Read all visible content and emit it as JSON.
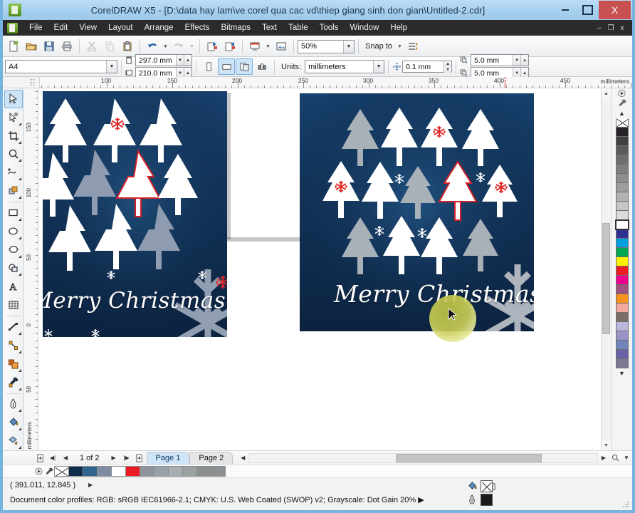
{
  "window": {
    "title": "CorelDRAW X5 - [D:\\data hay lam\\ve corel qua cac vd\\thiep giang sinh don gian\\Untitled-2.cdr]",
    "app_icon": "coreldraw-icon",
    "minimize_label": "–",
    "maximize_label": "❑",
    "close_label": "X"
  },
  "menubar": {
    "items": [
      {
        "label": "File"
      },
      {
        "label": "Edit"
      },
      {
        "label": "View"
      },
      {
        "label": "Layout"
      },
      {
        "label": "Arrange"
      },
      {
        "label": "Effects"
      },
      {
        "label": "Bitmaps"
      },
      {
        "label": "Text"
      },
      {
        "label": "Table"
      },
      {
        "label": "Tools"
      },
      {
        "label": "Window"
      },
      {
        "label": "Help"
      }
    ],
    "doc_minimize": "–",
    "doc_restore": "❐",
    "doc_close": "x"
  },
  "toolbar_standard": {
    "buttons": [
      {
        "name": "new-document-button",
        "icon": "new-page-icon"
      },
      {
        "name": "open-document-button",
        "icon": "folder-open-icon"
      },
      {
        "name": "save-document-button",
        "icon": "floppy-disk-icon"
      },
      {
        "name": "print-button",
        "icon": "printer-icon"
      },
      {
        "name": "cut-button",
        "icon": "scissors-icon"
      },
      {
        "name": "copy-button",
        "icon": "copy-icon"
      },
      {
        "name": "paste-button",
        "icon": "clipboard-icon"
      },
      {
        "name": "undo-button",
        "icon": "undo-arrow-icon"
      },
      {
        "name": "redo-button",
        "icon": "redo-arrow-icon"
      },
      {
        "name": "import-button",
        "icon": "import-icon"
      },
      {
        "name": "export-button",
        "icon": "export-icon"
      },
      {
        "name": "application-launcher-button",
        "icon": "app-launcher-icon"
      },
      {
        "name": "corel-online-button",
        "icon": "corel-online-icon"
      }
    ],
    "zoom_level": "50%",
    "snap_to_label": "Snap to",
    "options_icon": "options-icon"
  },
  "toolbar_properties": {
    "page_size": "A4",
    "page_width": "297.0 mm",
    "page_height": "210.0 mm",
    "orientation_portrait_icon": "portrait-icon",
    "orientation_landscape_icon": "landscape-icon",
    "all_pages_icon": "all-pages-icon",
    "current_page_icon": "current-page-icon",
    "units_label": "Units:",
    "units_value": "millimeters",
    "nudge_icon": "nudge-icon",
    "nudge_value": "0.1 mm",
    "duplicate_x_label": "x",
    "duplicate_x_value": "5.0 mm",
    "duplicate_y_label": "y",
    "duplicate_y_value": "5.0 mm"
  },
  "toolbox": {
    "tools": [
      {
        "name": "pick-tool",
        "icon": "arrow-cursor-icon",
        "active": true,
        "flyout": false
      },
      {
        "name": "shape-tool",
        "icon": "node-edit-icon",
        "active": false,
        "flyout": true
      },
      {
        "name": "crop-tool",
        "icon": "crop-icon",
        "active": false,
        "flyout": true
      },
      {
        "name": "zoom-tool",
        "icon": "magnifier-icon",
        "active": false,
        "flyout": true
      },
      {
        "name": "freehand-tool",
        "icon": "freehand-curve-icon",
        "active": false,
        "flyout": true
      },
      {
        "name": "smart-fill-tool",
        "icon": "smart-fill-icon",
        "active": false,
        "flyout": true
      },
      {
        "name": "rectangle-tool",
        "icon": "rectangle-icon",
        "active": false,
        "flyout": true
      },
      {
        "name": "ellipse-tool",
        "icon": "ellipse-icon",
        "active": false,
        "flyout": true
      },
      {
        "name": "polygon-tool",
        "icon": "polygon-icon",
        "active": false,
        "flyout": true
      },
      {
        "name": "basic-shapes-tool",
        "icon": "basic-shapes-icon",
        "active": false,
        "flyout": true
      },
      {
        "name": "text-tool",
        "icon": "letter-a-icon",
        "active": false,
        "flyout": false
      },
      {
        "name": "table-tool",
        "icon": "table-grid-icon",
        "active": false,
        "flyout": false
      },
      {
        "name": "dimension-tool",
        "icon": "dimension-line-icon",
        "active": false,
        "flyout": true
      },
      {
        "name": "connector-tool",
        "icon": "connector-line-icon",
        "active": false,
        "flyout": true
      },
      {
        "name": "blend-tool",
        "icon": "blend-icon",
        "active": false,
        "flyout": true
      },
      {
        "name": "color-eyedropper-tool",
        "icon": "eyedropper-icon",
        "active": false,
        "flyout": true
      },
      {
        "name": "outline-tool",
        "icon": "pen-nib-icon",
        "active": false,
        "flyout": true
      },
      {
        "name": "fill-tool",
        "icon": "paint-bucket-icon",
        "active": false,
        "flyout": true
      },
      {
        "name": "interactive-fill-tool",
        "icon": "interactive-fill-icon",
        "active": false,
        "flyout": true
      }
    ]
  },
  "rulers": {
    "horizontal_unit": "millimeters",
    "horizontal_labels": [
      "100",
      "150",
      "200",
      "250",
      "300",
      "350",
      "400",
      "450"
    ],
    "vertical_unit": "millimeters",
    "vertical_labels": [
      "150",
      "100",
      "50",
      "0",
      "50"
    ]
  },
  "canvas": {
    "card_left": {
      "name": "christmas-card-page-1",
      "greeting": "Merry Christmas",
      "background_color": "#123157",
      "tree_white": "#ffffff",
      "tree_grey": "#8e9bb0",
      "tree_red_outline": "#d32028",
      "snowflake_red": "#e02b2b",
      "snowflake_white": "#ffffff",
      "big_flake_color": "#9aa6b8"
    },
    "card_right": {
      "name": "christmas-card-page-2",
      "greeting": "Merry Christmas",
      "background_color": "#123157",
      "tree_white": "#ffffff",
      "tree_grey": "#a8b0b8",
      "tree_red_outline": "#d32028",
      "snowflake_red": "#e02b2b",
      "snowflake_white": "#ffffff",
      "big_flake_color": "#b6bcc4"
    },
    "cursor": {
      "name": "mouse-cursor",
      "glow_color": "#c5ca4e"
    }
  },
  "page_navigator": {
    "first_page_icon": "first-page-icon",
    "prev_page_icon": "prev-page-icon",
    "next_page_icon": "next-page-icon",
    "last_page_icon": "last-page-icon",
    "add_page_before_icon": "add-page-before-icon",
    "add_page_after_icon": "add-page-after-icon",
    "counter": "1 of 2",
    "tabs": [
      {
        "label": "Page 1",
        "active": true
      },
      {
        "label": "Page 2",
        "active": false
      }
    ]
  },
  "document_palette": {
    "expand_icon": "palette-expand-icon",
    "eyedropper_icon": "eyedropper-icon",
    "swatches": [
      {
        "name": "no-color",
        "color": "none"
      },
      {
        "name": "dark-navy",
        "color": "#0f2c4d"
      },
      {
        "name": "steel-blue",
        "color": "#2f648f"
      },
      {
        "name": "slate-blue-grey",
        "color": "#7d8ca3"
      },
      {
        "name": "white",
        "color": "#ffffff"
      },
      {
        "name": "red",
        "color": "#ec1c24"
      },
      {
        "name": "grey-1",
        "color": "#8d949b"
      },
      {
        "name": "grey-2",
        "color": "#98a0a8"
      },
      {
        "name": "grey-3",
        "color": "#a8adb2"
      },
      {
        "name": "grey-4",
        "color": "#9aa3a2"
      },
      {
        "name": "grey-5",
        "color": "#8b8f90"
      },
      {
        "name": "grey-6",
        "color": "#8c9092"
      }
    ]
  },
  "color_palette": {
    "expand_icon": "palette-menu-icon",
    "eyedropper_icon": "eyedropper-icon",
    "scroll_up_icon": "scroll-up-icon",
    "scroll_down_icon": "scroll-down-icon",
    "swatches": [
      {
        "name": "no-color",
        "color": "none"
      },
      {
        "name": "black",
        "color": "#262228"
      },
      {
        "name": "grey-90",
        "color": "#3f3f42"
      },
      {
        "name": "grey-80",
        "color": "#5a5a5c"
      },
      {
        "name": "grey-70",
        "color": "#6e6e70"
      },
      {
        "name": "grey-60",
        "color": "#808082"
      },
      {
        "name": "grey-50",
        "color": "#8e8e90"
      },
      {
        "name": "grey-40",
        "color": "#9d9da0"
      },
      {
        "name": "grey-30",
        "color": "#b2b2b4"
      },
      {
        "name": "grey-20",
        "color": "#c6c6c8"
      },
      {
        "name": "grey-10",
        "color": "#dcdcde"
      },
      {
        "name": "white",
        "color": "#ffffff",
        "selected": true
      },
      {
        "name": "dark-blue",
        "color": "#2e3192"
      },
      {
        "name": "cyan",
        "color": "#00a0e0"
      },
      {
        "name": "green",
        "color": "#00a651"
      },
      {
        "name": "yellow",
        "color": "#fff200"
      },
      {
        "name": "red",
        "color": "#ed1c24"
      },
      {
        "name": "magenta",
        "color": "#ec008c"
      },
      {
        "name": "purple-rose",
        "color": "#a0527e"
      },
      {
        "name": "orange",
        "color": "#f7941e"
      },
      {
        "name": "pink",
        "color": "#f2a9a0"
      },
      {
        "name": "warm-grey",
        "color": "#7d6f67"
      },
      {
        "name": "light-violet",
        "color": "#bdb7e0"
      },
      {
        "name": "violet",
        "color": "#9a93c8"
      },
      {
        "name": "steel-blue",
        "color": "#6f84b8"
      },
      {
        "name": "indigo",
        "color": "#6b63a8"
      },
      {
        "name": "mauve",
        "color": "#7f7894"
      }
    ]
  },
  "status_bar": {
    "coordinates": "( 391.011, 12.845 )",
    "coordinates_arrow": "▶",
    "color_profiles": "Document color profiles: RGB: sRGB IEC61966-2.1; CMYK: U.S. Web Coated (SWOP) v2; Grayscale: Dot Gain 20%",
    "color_profiles_arrow": "▶",
    "snapshot_icon": "snapshot-icon",
    "fill_icon": "fill-bucket-icon",
    "fill_value": "none",
    "outline_icon": "outline-pen-icon",
    "outline_color": "#1a1a1a"
  },
  "scrollbars": {
    "vertical_up_icon": "chevron-up-icon",
    "vertical_down_icon": "chevron-down-icon",
    "horizontal_left_icon": "chevron-left-icon",
    "horizontal_right_icon": "chevron-right-icon",
    "zoom_icon": "zoom-icon",
    "dropdown_icon": "chevron-down-icon",
    "collapse_icon": "collapse-icon"
  }
}
